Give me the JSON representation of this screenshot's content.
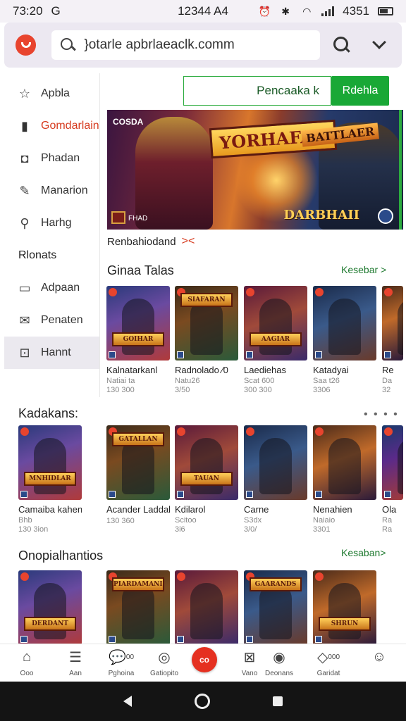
{
  "status": {
    "time": "73:20",
    "carrier": "G",
    "center": "12344 A4",
    "battery": "4351"
  },
  "topbar": {
    "url": "}otarle apbrlaeaclk.comm"
  },
  "sidebar": {
    "items": [
      {
        "label": "Apbla",
        "icon": "star-icon"
      },
      {
        "label": "Gomdarlain",
        "icon": "folder-icon"
      },
      {
        "label": "Phadan",
        "icon": "camera-icon"
      },
      {
        "label": "Manarion",
        "icon": "pen-icon"
      },
      {
        "label": "Harhg",
        "icon": "search-icon"
      }
    ],
    "heading": "Rlonats",
    "items2": [
      {
        "label": "Adpaan",
        "icon": "chat-icon"
      },
      {
        "label": "Penaten",
        "icon": "mail-icon"
      },
      {
        "label": "Hannt",
        "icon": "tag-icon"
      }
    ]
  },
  "install": {
    "package": "Pencaaka k",
    "button": "Rdehla"
  },
  "banner": {
    "badge": "COSDA",
    "logo_main": "YORHAFAR",
    "logo_right": "BATTLAER",
    "logo_bottom": "DARBHAII",
    "corner_label": "FHAD",
    "caption": "Renbahiodand",
    "caption_icon": "close-icon"
  },
  "sections": {
    "games": {
      "title": "Ginaa Talas",
      "more": "Kesebar >"
    },
    "featured": {
      "title": "Kadakans:"
    },
    "popular": {
      "title": "Onopialhantios",
      "more": "Kesaban>"
    }
  },
  "games_row": [
    {
      "name": "Kalnatarkanl",
      "sub": "Natiai ta",
      "meta": "130 300",
      "plate": "GOIHAR"
    },
    {
      "name": "Radnolado  ⁄0",
      "sub": "Natu26",
      "meta": "3/50",
      "plate": "SIAFARAN"
    },
    {
      "name": "Laediehas",
      "sub": "Scat 600",
      "meta": "300 300",
      "plate": "AAGIAR"
    },
    {
      "name": "Katadyai",
      "sub": "Saa t26",
      "meta": "3306",
      "plate": ""
    },
    {
      "name": "Re",
      "sub": "Da",
      "meta": "32",
      "plate": ""
    }
  ],
  "featured_row": [
    {
      "name": "Camaiba kahent",
      "sub": "Bhb",
      "meta": "130 3ion",
      "plate": "MNHIDLAR"
    },
    {
      "name": "Acander  Laddahion",
      "sub": "",
      "meta": "130 360",
      "plate": "GATALLAN"
    },
    {
      "name": "Kdilarol",
      "sub": "Scitoo",
      "meta": "3i6",
      "plate": "TAUAN"
    },
    {
      "name": "Carne",
      "sub": "S3dx",
      "meta": "3/0/",
      "plate": ""
    },
    {
      "name": "Nenahien",
      "sub": "Naiaio",
      "meta": "3301",
      "plate": ""
    },
    {
      "name": "Ola",
      "sub": "Ra",
      "meta": "Ra",
      "plate": ""
    }
  ],
  "popular_row": [
    {
      "plate": "DERDANT"
    },
    {
      "plate": "PIARDAMANIE"
    },
    {
      "plate": ""
    },
    {
      "plate": "GAARANDS"
    },
    {
      "plate": "SHRUN"
    }
  ],
  "bottom_nav": [
    {
      "label": "Ooo",
      "icon": "home-icon"
    },
    {
      "label": "Aan",
      "icon": "menu-icon"
    },
    {
      "label": "Pghoina",
      "icon": "chat-icon",
      "badge": "00"
    },
    {
      "label": "Gatiopito",
      "icon": "compass-icon"
    },
    {
      "label": "Vano",
      "icon": "bag-icon"
    },
    {
      "label": "Deonans",
      "icon": "user-icon"
    },
    {
      "label": "Garidat",
      "icon": "tag-icon",
      "badge": "000"
    },
    {
      "label": "",
      "icon": "smile-icon"
    }
  ],
  "fab": {
    "label": "co"
  },
  "colors": {
    "accent_red": "#e53020",
    "accent_green": "#19a836",
    "link_green": "#1f7a30"
  }
}
